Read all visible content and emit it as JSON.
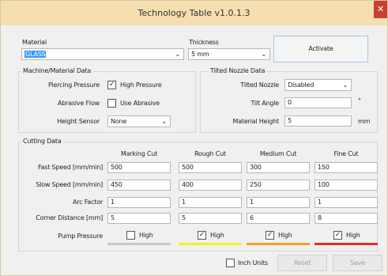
{
  "window": {
    "title": "Technology Table v1.0.1.3",
    "close_glyph": "✕"
  },
  "top": {
    "material_label": "Material",
    "material_value": "GLASS",
    "thickness_label": "Thickness",
    "thickness_value": "5 mm",
    "activate_label": "Activate"
  },
  "machine": {
    "title": "Machine/Material Data",
    "piercing_label": "Piercing Pressure",
    "piercing_option": "High Pressure",
    "piercing_checked": true,
    "abrasive_label": "Abrasive Flow",
    "abrasive_option": "Use Abrasive",
    "abrasive_checked": false,
    "height_label": "Height Sensor",
    "height_value": "None"
  },
  "nozzle": {
    "title": "Tilted Nozzle Data",
    "tilted_label": "Tilted Nozzle",
    "tilted_value": "Disabled",
    "tilt_label": "Tilt Angle",
    "tilt_value": "0",
    "tilt_unit": "°",
    "height_label": "Material Height",
    "height_value": "5",
    "height_unit": "mm"
  },
  "cutting": {
    "title": "Cutting Data",
    "columns": [
      "Marking Cut",
      "Rough Cut",
      "Medium Cut",
      "Fine Cut"
    ],
    "rows": [
      {
        "label": "Fast Speed [mm/min]",
        "values": [
          "500",
          "500",
          "300",
          "150"
        ]
      },
      {
        "label": "Slow Speed [mm/min]",
        "values": [
          "450",
          "400",
          "250",
          "100"
        ]
      },
      {
        "label": "Arc Factor",
        "values": [
          "1",
          "1",
          "1",
          "1"
        ]
      },
      {
        "label": "Corner Distance [mm]",
        "values": [
          "5",
          "5",
          "6",
          "8"
        ]
      }
    ],
    "pump_label": "Pump Pressure",
    "pump": [
      {
        "label": "High",
        "checked": false,
        "color": "#c8c8c8"
      },
      {
        "label": "High",
        "checked": true,
        "color": "#f2ef28"
      },
      {
        "label": "High",
        "checked": true,
        "color": "#f2a024"
      },
      {
        "label": "High",
        "checked": true,
        "color": "#e02d2a"
      }
    ]
  },
  "footer": {
    "inch_label": "Inch Units",
    "inch_checked": false,
    "reset_label": "Reset",
    "save_label": "Save"
  },
  "icons": {
    "check": "✓",
    "chevron": "⌄"
  }
}
